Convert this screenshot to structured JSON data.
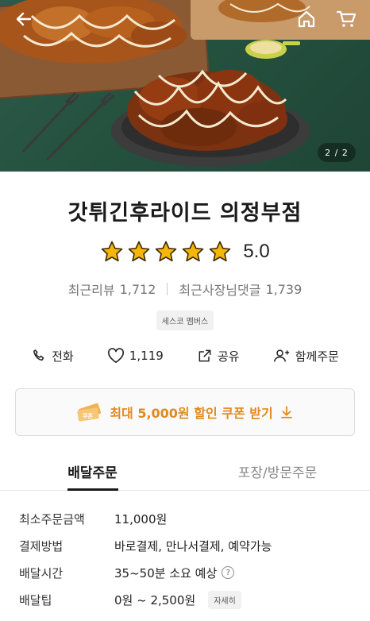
{
  "hero": {
    "page_indicator": "2 / 2",
    "icons": {
      "back": "back-arrow-icon",
      "home": "home-icon",
      "cart": "cart-icon"
    }
  },
  "store": {
    "name": "갓튀긴후라이드 의정부점",
    "rating": "5.0",
    "stars": 5,
    "recent_reviews_label": "최근리뷰",
    "recent_reviews_count": "1,712",
    "owner_replies_label": "최근사장님댓글",
    "owner_replies_count": "1,739",
    "badge": "세스코 멤버스"
  },
  "actions": {
    "call": "전화",
    "like_count": "1,119",
    "share": "공유",
    "group_order": "함께주문"
  },
  "coupon": {
    "label": "최대 5,000원 할인 쿠폰 받기"
  },
  "tabs": [
    {
      "label": "배달주문",
      "active": true
    },
    {
      "label": "포장/방문주문",
      "active": false
    }
  ],
  "info": {
    "min_order_label": "최소주문금액",
    "min_order_value": "11,000원",
    "payment_label": "결제방법",
    "payment_value": "바로결제, 만나서결제, 예약가능",
    "delivery_time_label": "배달시간",
    "delivery_time_value": "35~50분 소요 예상",
    "delivery_tip_label": "배달팁",
    "delivery_tip_value": "0원 ~ 2,500원",
    "detail_button": "자세히"
  },
  "colors": {
    "accent": "#e08a1e",
    "star": "#f5b60a",
    "text": "#222222"
  }
}
